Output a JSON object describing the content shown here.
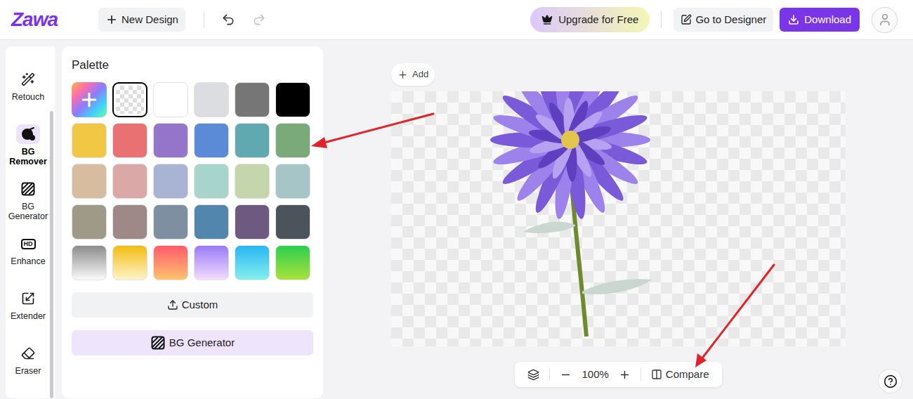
{
  "topbar": {
    "logo": "Zawa",
    "new_design": "New Design",
    "undo": {
      "disabled": false
    },
    "redo": {
      "disabled": true
    },
    "upgrade": "Upgrade for Free",
    "designer": "Go to Designer",
    "download": "Download"
  },
  "sidebar": {
    "items": [
      {
        "label": "Retouch",
        "selected": false
      },
      {
        "label": "BG Remover",
        "selected": true
      },
      {
        "label": "BG Generator",
        "selected": false
      },
      {
        "label": "Enhance",
        "selected": false,
        "icon_text": "HD"
      },
      {
        "label": "Extender",
        "selected": false
      },
      {
        "label": "Eraser",
        "selected": false
      }
    ]
  },
  "palette": {
    "title": "Palette",
    "swatches": [
      {
        "kind": "add",
        "selected": false
      },
      {
        "kind": "transparent",
        "selected": true
      },
      {
        "kind": "solid",
        "color": "#ffffff",
        "selected": false
      },
      {
        "kind": "solid",
        "color": "#dcdde1",
        "selected": false
      },
      {
        "kind": "solid",
        "color": "#767676",
        "selected": false
      },
      {
        "kind": "solid",
        "color": "#000000",
        "selected": false
      },
      {
        "kind": "solid",
        "color": "#f2c744",
        "selected": false
      },
      {
        "kind": "solid",
        "color": "#e97171",
        "selected": false
      },
      {
        "kind": "solid",
        "color": "#9575c9",
        "selected": false
      },
      {
        "kind": "solid",
        "color": "#5b8bd6",
        "selected": false
      },
      {
        "kind": "solid",
        "color": "#60a9b0",
        "selected": false
      },
      {
        "kind": "solid",
        "color": "#7aaa7a",
        "selected": false
      },
      {
        "kind": "solid",
        "color": "#d8bca0",
        "selected": false
      },
      {
        "kind": "solid",
        "color": "#dba8a8",
        "selected": false
      },
      {
        "kind": "solid",
        "color": "#a9b3d4",
        "selected": false
      },
      {
        "kind": "solid",
        "color": "#a8d5cb",
        "selected": false
      },
      {
        "kind": "solid",
        "color": "#c5d6ad",
        "selected": false
      },
      {
        "kind": "solid",
        "color": "#a6c5c7",
        "selected": false
      },
      {
        "kind": "solid",
        "color": "#9f9a88",
        "selected": false
      },
      {
        "kind": "solid",
        "color": "#9f8888",
        "selected": false
      },
      {
        "kind": "solid",
        "color": "#7f8fa2",
        "selected": false
      },
      {
        "kind": "solid",
        "color": "#5286ad",
        "selected": false
      },
      {
        "kind": "solid",
        "color": "#6e5a80",
        "selected": false
      },
      {
        "kind": "solid",
        "color": "#4d535b",
        "selected": false
      },
      {
        "kind": "gradient",
        "colors": [
          "#8c8c8c",
          "#fafafa"
        ],
        "selected": false
      },
      {
        "kind": "gradient",
        "colors": [
          "#f2bd12",
          "#fff4c8"
        ],
        "selected": false
      },
      {
        "kind": "gradient",
        "colors": [
          "#ff5a6a",
          "#ffc36e"
        ],
        "selected": false
      },
      {
        "kind": "gradient",
        "colors": [
          "#9a7bf5",
          "#f3dcff"
        ],
        "selected": false
      },
      {
        "kind": "gradient",
        "colors": [
          "#28b6f2",
          "#85f0ee"
        ],
        "selected": false
      },
      {
        "kind": "gradient",
        "colors": [
          "#2bcf4f",
          "#a9e23a"
        ],
        "selected": false
      }
    ],
    "buttons": [
      {
        "label": "Custom",
        "kind": "upload"
      },
      {
        "label": "BG Generator",
        "kind": "generator"
      }
    ]
  },
  "canvas": {
    "add": "Add",
    "zoom": "100%",
    "compare": "Compare"
  }
}
